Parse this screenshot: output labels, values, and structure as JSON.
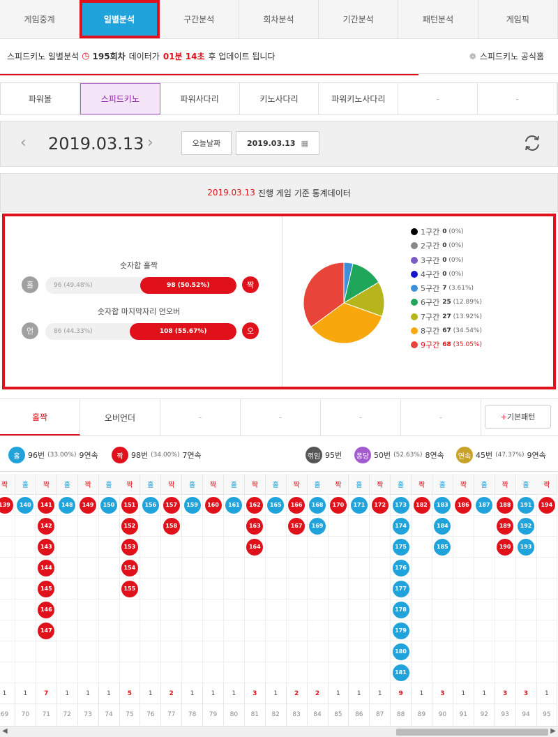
{
  "top_tabs": [
    "게임중계",
    "일별분석",
    "구간분석",
    "회차분석",
    "기간분석",
    "패턴분석",
    "게임픽"
  ],
  "top_active": 1,
  "info": {
    "game": "스피드키노 일별분석",
    "round": "195회차",
    "mid": "데이터가",
    "time": "01분 14초",
    "tail": "후 업데이트 됩니다",
    "official": "스피드키노 공식홈"
  },
  "game_tabs": [
    "파워볼",
    "스피드키노",
    "파워사다리",
    "키노사다리",
    "파워키노사다리",
    "-",
    "-"
  ],
  "game_active": 1,
  "date": {
    "current": "2019.03.13",
    "today_btn": "오늘날짜",
    "picker": "2019.03.13"
  },
  "stats_header": {
    "date": "2019.03.13",
    "text": "진행 게임 기준 통계데이터"
  },
  "bars": [
    {
      "title": "숫자합 홀짝",
      "left_badge": "홀",
      "right_badge": "짝",
      "left_text": "96 (49.48%)",
      "right_text": "98 (50.52%)",
      "right_pct": 50.52,
      "left_color": "#a0a0a0",
      "right_color": "#e0111a"
    },
    {
      "title": "숫자합 마지막자리 언오버",
      "left_badge": "언",
      "right_badge": "오",
      "left_text": "86 (44.33%)",
      "right_text": "108 (55.67%)",
      "right_pct": 55.67,
      "left_color": "#a0a0a0",
      "right_color": "#e0111a"
    }
  ],
  "pie": [
    {
      "label": "1구간",
      "count": "0",
      "pct": "(0%)",
      "value": 0,
      "color": "#000000"
    },
    {
      "label": "2구간",
      "count": "0",
      "pct": "(0%)",
      "value": 0,
      "color": "#888888"
    },
    {
      "label": "3구간",
      "count": "0",
      "pct": "(0%)",
      "value": 0,
      "color": "#7b5cc4"
    },
    {
      "label": "4구간",
      "count": "0",
      "pct": "(0%)",
      "value": 0,
      "color": "#1616c8"
    },
    {
      "label": "5구간",
      "count": "7",
      "pct": "(3.61%)",
      "value": 7,
      "color": "#3d8fd8"
    },
    {
      "label": "6구간",
      "count": "25",
      "pct": "(12.89%)",
      "value": 25,
      "color": "#20a65a"
    },
    {
      "label": "7구간",
      "count": "27",
      "pct": "(13.92%)",
      "value": 27,
      "color": "#b7b51c"
    },
    {
      "label": "8구간",
      "count": "67",
      "pct": "(34.54%)",
      "value": 67,
      "color": "#f8a70c"
    },
    {
      "label": "9구간",
      "count": "68",
      "pct": "(35.05%)",
      "value": 68,
      "color": "#e8443a"
    }
  ],
  "bottom_tabs": [
    "홀짝",
    "오버언더",
    "-",
    "-",
    "-",
    "-"
  ],
  "pattern_btn": {
    "plus": "+",
    "label": "기본패턴"
  },
  "summary": {
    "odd": {
      "badge": "홀",
      "count": "96번",
      "pct": "(33.00%)",
      "streak": "9연속",
      "color": "#1fa3da"
    },
    "even": {
      "badge": "짝",
      "count": "98번",
      "pct": "(34.00%)",
      "streak": "7연속",
      "color": "#e0111a"
    },
    "flip": {
      "badge": "꺾임",
      "count": "95번",
      "color": "#555555"
    },
    "bounce": {
      "badge": "퐁당",
      "count": "50번",
      "pct": "(52.63%)",
      "streak": "8연속",
      "color": "#a45bd0"
    },
    "consec": {
      "badge": "연속",
      "count": "45번",
      "pct": "(47.37%)",
      "streak": "9연속",
      "color": "#c9a22a"
    }
  },
  "colors": {
    "odd": "#1fa3da",
    "even": "#e0111a"
  },
  "columns": [
    {
      "type": "짝",
      "balls": [
        "139"
      ],
      "count": "1",
      "num": "69"
    },
    {
      "type": "홀",
      "balls": [
        "140"
      ],
      "count": "1",
      "num": "70"
    },
    {
      "type": "짝",
      "balls": [
        "141",
        "142",
        "143",
        "144",
        "145",
        "146",
        "147"
      ],
      "count": "7",
      "num": "71"
    },
    {
      "type": "홀",
      "balls": [
        "148"
      ],
      "count": "1",
      "num": "72"
    },
    {
      "type": "짝",
      "balls": [
        "149"
      ],
      "count": "1",
      "num": "73"
    },
    {
      "type": "홀",
      "balls": [
        "150"
      ],
      "count": "1",
      "num": "74"
    },
    {
      "type": "짝",
      "balls": [
        "151",
        "152",
        "153",
        "154",
        "155"
      ],
      "count": "5",
      "num": "75"
    },
    {
      "type": "홀",
      "balls": [
        "156"
      ],
      "count": "1",
      "num": "76"
    },
    {
      "type": "짝",
      "balls": [
        "157",
        "158"
      ],
      "count": "2",
      "num": "77"
    },
    {
      "type": "홀",
      "balls": [
        "159"
      ],
      "count": "1",
      "num": "78"
    },
    {
      "type": "짝",
      "balls": [
        "160"
      ],
      "count": "1",
      "num": "79"
    },
    {
      "type": "홀",
      "balls": [
        "161"
      ],
      "count": "1",
      "num": "80"
    },
    {
      "type": "짝",
      "balls": [
        "162",
        "163",
        "164"
      ],
      "count": "3",
      "num": "81"
    },
    {
      "type": "홀",
      "balls": [
        "165"
      ],
      "count": "1",
      "num": "82"
    },
    {
      "type": "짝",
      "balls": [
        "166",
        "167"
      ],
      "count": "2",
      "num": "83"
    },
    {
      "type": "홀",
      "balls": [
        "168",
        "169"
      ],
      "count": "2",
      "num": "84"
    },
    {
      "type": "짝",
      "balls": [
        "170"
      ],
      "count": "1",
      "num": "85"
    },
    {
      "type": "홀",
      "balls": [
        "171"
      ],
      "count": "1",
      "num": "86"
    },
    {
      "type": "짝",
      "balls": [
        "172"
      ],
      "count": "1",
      "num": "87"
    },
    {
      "type": "홀",
      "balls": [
        "173",
        "174",
        "175",
        "176",
        "177",
        "178",
        "179",
        "180",
        "181"
      ],
      "count": "9",
      "num": "88"
    },
    {
      "type": "짝",
      "balls": [
        "182"
      ],
      "count": "1",
      "num": "89"
    },
    {
      "type": "홀",
      "balls": [
        "183",
        "184",
        "185"
      ],
      "count": "3",
      "num": "90"
    },
    {
      "type": "짝",
      "balls": [
        "186"
      ],
      "count": "1",
      "num": "91"
    },
    {
      "type": "홀",
      "balls": [
        "187"
      ],
      "count": "1",
      "num": "92"
    },
    {
      "type": "짝",
      "balls": [
        "188",
        "189",
        "190"
      ],
      "count": "3",
      "num": "93"
    },
    {
      "type": "홀",
      "balls": [
        "191",
        "192",
        "193"
      ],
      "count": "3",
      "num": "94"
    },
    {
      "type": "짝",
      "balls": [
        "194"
      ],
      "count": "1",
      "num": "95"
    }
  ],
  "grid_rows": 9
}
